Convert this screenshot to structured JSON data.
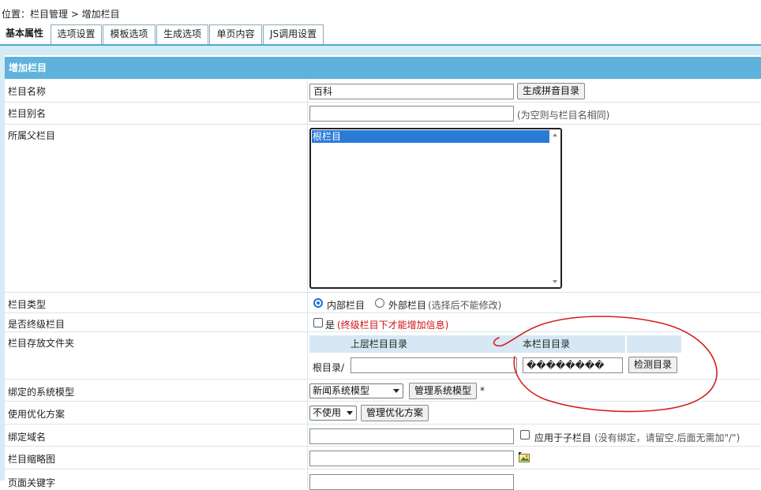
{
  "breadcrumb": "位置：栏目管理 > 增加栏目",
  "tabs": [
    {
      "label": "基本属性"
    },
    {
      "label": "选项设置"
    },
    {
      "label": "模板选项"
    },
    {
      "label": "生成选项"
    },
    {
      "label": "单页内容"
    },
    {
      "label": "JS调用设置"
    }
  ],
  "section_title": "增加栏目",
  "form": {
    "name": {
      "label": "栏目名称",
      "value": "百科",
      "button": "生成拼音目录"
    },
    "alias": {
      "label": "栏目别名",
      "value": "",
      "hint": "(为空则与栏目名相同)"
    },
    "parent": {
      "label": "所属父栏目",
      "options": [
        "根栏目"
      ]
    },
    "type": {
      "label": "栏目类型",
      "option_internal": "内部栏目",
      "option_external": "外部栏目",
      "hint": "(选择后不能修改)"
    },
    "final": {
      "label": "是否终级栏目",
      "option": "是",
      "hint": "(终级栏目下才能增加信息)"
    },
    "folder": {
      "label": "栏目存放文件夹",
      "col_parent": "上层栏目目录",
      "col_self": "本栏目目录",
      "root_prefix": "根目录/",
      "parent_value": "",
      "self_value": "��������",
      "button": "检测目录"
    },
    "model": {
      "label": "绑定的系统模型",
      "selected": "新闻系统模型",
      "button": "管理系统模型",
      "required_mark": "*"
    },
    "optimize": {
      "label": "使用优化方案",
      "selected": "不使用",
      "button": "管理优化方案"
    },
    "domain": {
      "label": "绑定域名",
      "value": "",
      "checkbox_label": "应用于子栏目",
      "hint": "(没有绑定，请留空.后面无需加\"/\")"
    },
    "thumbnail": {
      "label": "栏目缩略图",
      "value": ""
    },
    "keywords": {
      "label": "页面关键字",
      "value": ""
    }
  },
  "colors": {
    "accent": "#5fb2db",
    "annotation": "#d21f1f",
    "hint_red": "#cc1111"
  }
}
